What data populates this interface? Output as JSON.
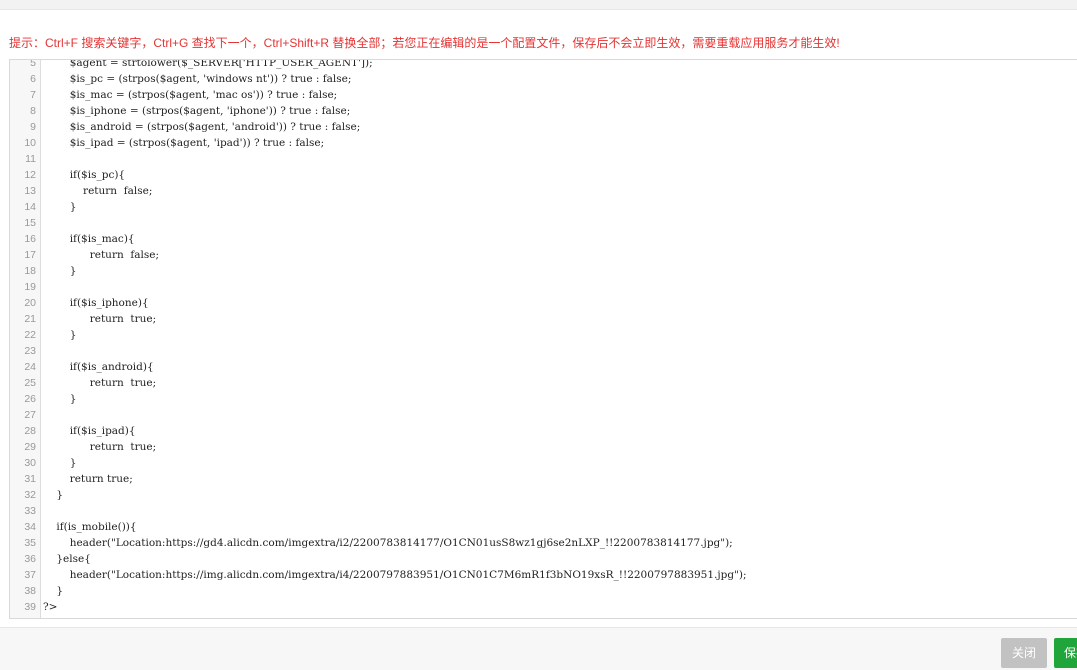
{
  "hint": {
    "text": "提示：Ctrl+F 搜索关键字，Ctrl+G 查找下一个，Ctrl+Shift+R 替换全部；若您正在编辑的是一个配置文件，保存后不会立即生效，需要重载应用服务才能生效!"
  },
  "editor": {
    "lines": [
      {
        "num": "5",
        "text": "        $agent = strtolower($_SERVER['HTTP_USER_AGENT']);"
      },
      {
        "num": "6",
        "text": "        $is_pc = (strpos($agent, 'windows nt')) ? true : false;"
      },
      {
        "num": "7",
        "text": "        $is_mac = (strpos($agent, 'mac os')) ? true : false;"
      },
      {
        "num": "8",
        "text": "        $is_iphone = (strpos($agent, 'iphone')) ? true : false;"
      },
      {
        "num": "9",
        "text": "        $is_android = (strpos($agent, 'android')) ? true : false;"
      },
      {
        "num": "10",
        "text": "        $is_ipad = (strpos($agent, 'ipad')) ? true : false;"
      },
      {
        "num": "11",
        "text": ""
      },
      {
        "num": "12",
        "text": "        if($is_pc){"
      },
      {
        "num": "13",
        "text": "            return  false;"
      },
      {
        "num": "14",
        "text": "        }"
      },
      {
        "num": "15",
        "text": ""
      },
      {
        "num": "16",
        "text": "        if($is_mac){"
      },
      {
        "num": "17",
        "text": "              return  false;"
      },
      {
        "num": "18",
        "text": "        }"
      },
      {
        "num": "19",
        "text": ""
      },
      {
        "num": "20",
        "text": "        if($is_iphone){"
      },
      {
        "num": "21",
        "text": "              return  true;"
      },
      {
        "num": "22",
        "text": "        }"
      },
      {
        "num": "23",
        "text": ""
      },
      {
        "num": "24",
        "text": "        if($is_android){"
      },
      {
        "num": "25",
        "text": "              return  true;"
      },
      {
        "num": "26",
        "text": "        }"
      },
      {
        "num": "27",
        "text": ""
      },
      {
        "num": "28",
        "text": "        if($is_ipad){"
      },
      {
        "num": "29",
        "text": "              return  true;"
      },
      {
        "num": "30",
        "text": "        }"
      },
      {
        "num": "31",
        "text": "        return true;"
      },
      {
        "num": "32",
        "text": "    }"
      },
      {
        "num": "33",
        "text": ""
      },
      {
        "num": "34",
        "text": "    if(is_mobile()){"
      },
      {
        "num": "35",
        "text": "        header(\"Location:https://gd4.alicdn.com/imgextra/i2/2200783814177/O1CN01usS8wz1gj6se2nLXP_!!2200783814177.jpg\");"
      },
      {
        "num": "36",
        "text": "    }else{"
      },
      {
        "num": "37",
        "text": "        header(\"Location:https://img.alicdn.com/imgextra/i4/2200797883951/O1CN01C7M6mR1f3bNO19xsR_!!2200797883951.jpg\");"
      },
      {
        "num": "38",
        "text": "    }"
      },
      {
        "num": "39",
        "text": "?>"
      }
    ]
  },
  "footer": {
    "close_label": "关闭",
    "save_label": "保存"
  },
  "colors": {
    "hint": "#e53333",
    "save": "#20a53a",
    "close": "#c2c2c2"
  }
}
